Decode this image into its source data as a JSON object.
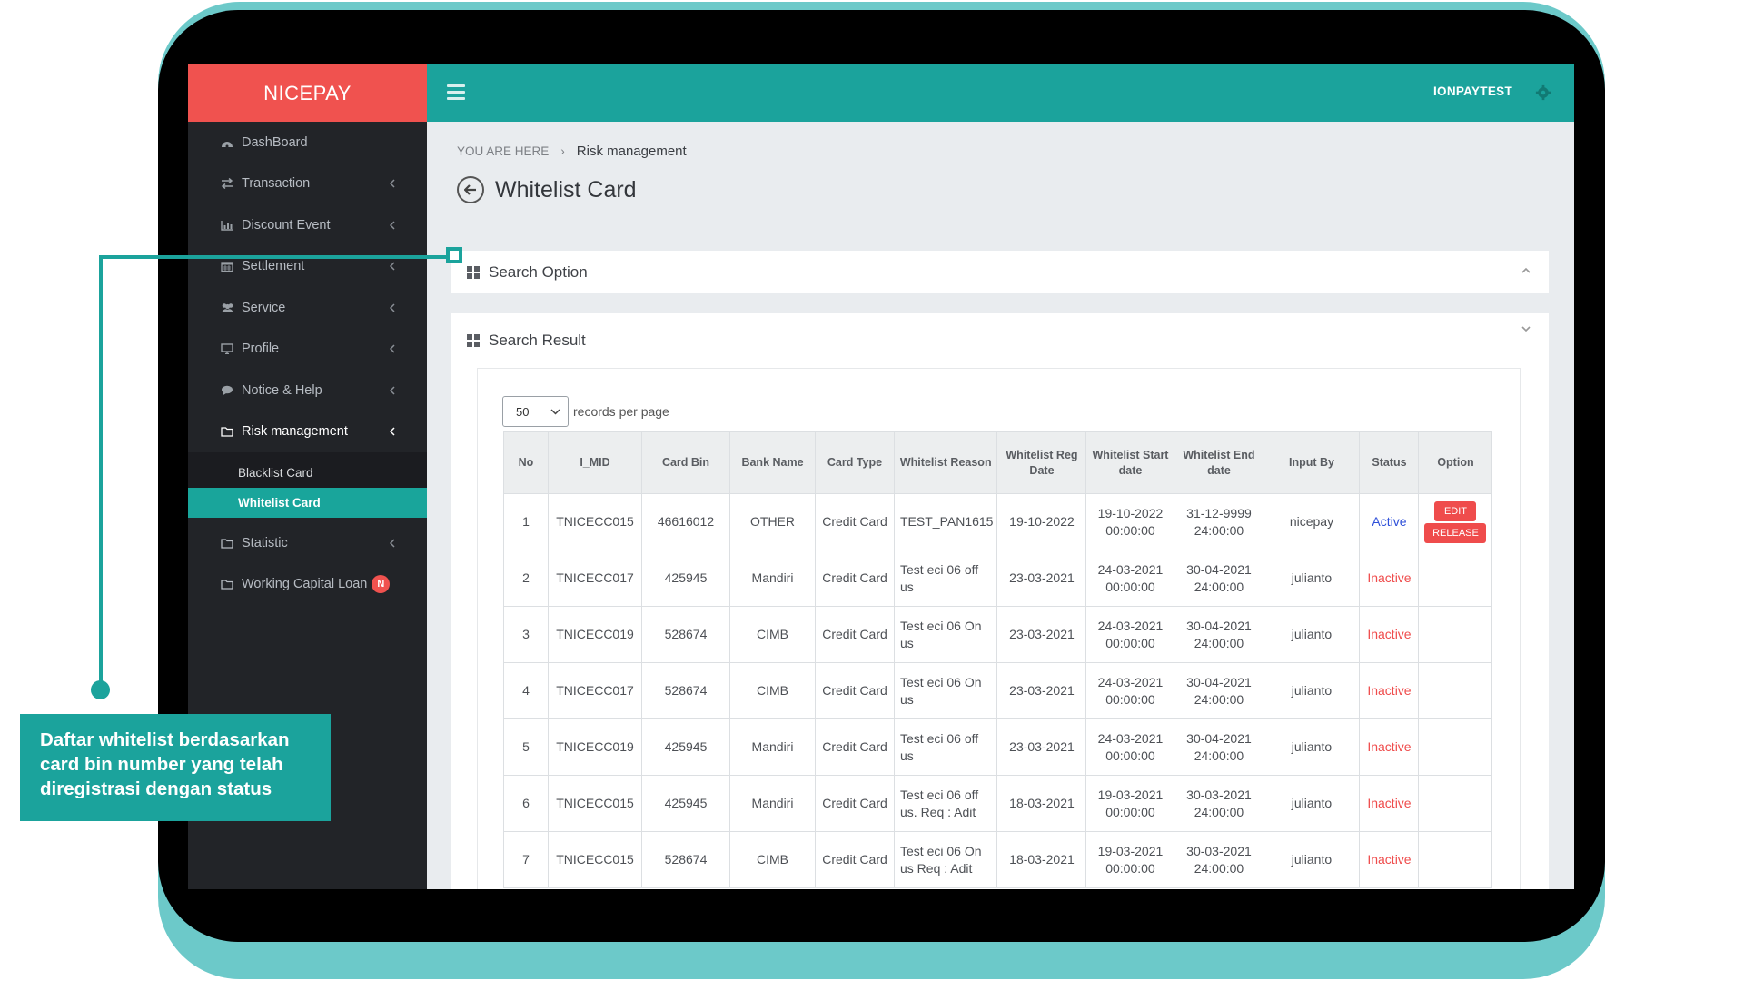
{
  "brand": "NICEPAY",
  "topbar": {
    "username": "IONPAYTEST"
  },
  "sidebar": {
    "items": [
      {
        "label": "DashBoard",
        "icon": "dashboard-icon",
        "has_chevron": false
      },
      {
        "label": "Transaction",
        "icon": "exchange-icon",
        "has_chevron": true
      },
      {
        "label": "Discount Event",
        "icon": "bar-chart-icon",
        "has_chevron": true
      },
      {
        "label": "Settlement",
        "icon": "calendar-icon",
        "has_chevron": true
      },
      {
        "label": "Service",
        "icon": "users-icon",
        "has_chevron": true
      },
      {
        "label": "Profile",
        "icon": "monitor-icon",
        "has_chevron": true
      },
      {
        "label": "Notice & Help",
        "icon": "chat-icon",
        "has_chevron": true
      },
      {
        "label": "Risk management",
        "icon": "folder-icon",
        "has_chevron": true,
        "active": true
      }
    ],
    "submenu": [
      {
        "label": "Blacklist Card"
      },
      {
        "label": "Whitelist Card",
        "selected": true
      }
    ],
    "items_after": [
      {
        "label": "Statistic",
        "icon": "folder-icon",
        "has_chevron": true
      },
      {
        "label": "Working Capital Loan",
        "icon": "folder-icon",
        "badge": "N"
      }
    ]
  },
  "breadcrumb": {
    "prefix": "YOU ARE HERE",
    "separator": "›",
    "current": "Risk management"
  },
  "page": {
    "title": "Whitelist Card"
  },
  "search_option": {
    "title": "Search Option"
  },
  "search_result": {
    "title": "Search Result",
    "page_length": "50",
    "page_length_label": "records per page",
    "columns": [
      "No",
      "I_MID",
      "Card Bin",
      "Bank Name",
      "Card Type",
      "Whitelist Reason",
      "Whitelist Reg Date",
      "Whitelist Start date",
      "Whitelist End date",
      "Input By",
      "Status",
      "Option"
    ],
    "rows": [
      {
        "no": "1",
        "mid": "TNICECC015",
        "bin": "46616012",
        "bank": "OTHER",
        "type": "Credit Card",
        "reason": "TEST_PAN1615",
        "reg": "19-10-2022",
        "start": "19-10-2022 00:00:00",
        "end": "31-12-9999 24:00:00",
        "by": "nicepay",
        "status": "Active",
        "edit": "EDIT",
        "release": "RELEASE"
      },
      {
        "no": "2",
        "mid": "TNICECC017",
        "bin": "425945",
        "bank": "Mandiri",
        "type": "Credit Card",
        "reason": "Test eci 06 off us",
        "reg": "23-03-2021",
        "start": "24-03-2021 00:00:00",
        "end": "30-04-2021 24:00:00",
        "by": "julianto",
        "status": "Inactive"
      },
      {
        "no": "3",
        "mid": "TNICECC019",
        "bin": "528674",
        "bank": "CIMB",
        "type": "Credit Card",
        "reason": "Test eci 06 On us",
        "reg": "23-03-2021",
        "start": "24-03-2021 00:00:00",
        "end": "30-04-2021 24:00:00",
        "by": "julianto",
        "status": "Inactive"
      },
      {
        "no": "4",
        "mid": "TNICECC017",
        "bin": "528674",
        "bank": "CIMB",
        "type": "Credit Card",
        "reason": "Test eci 06 On us",
        "reg": "23-03-2021",
        "start": "24-03-2021 00:00:00",
        "end": "30-04-2021 24:00:00",
        "by": "julianto",
        "status": "Inactive"
      },
      {
        "no": "5",
        "mid": "TNICECC019",
        "bin": "425945",
        "bank": "Mandiri",
        "type": "Credit Card",
        "reason": "Test eci 06 off us",
        "reg": "23-03-2021",
        "start": "24-03-2021 00:00:00",
        "end": "30-04-2021 24:00:00",
        "by": "julianto",
        "status": "Inactive"
      },
      {
        "no": "6",
        "mid": "TNICECC015",
        "bin": "425945",
        "bank": "Mandiri",
        "type": "Credit Card",
        "reason": "Test eci 06 off us. Req : Adit",
        "reg": "18-03-2021",
        "start": "19-03-2021 00:00:00",
        "end": "30-03-2021 24:00:00",
        "by": "julianto",
        "status": "Inactive"
      },
      {
        "no": "7",
        "mid": "TNICECC015",
        "bin": "528674",
        "bank": "CIMB",
        "type": "Credit Card",
        "reason": "Test eci 06 On us Req : Adit",
        "reg": "18-03-2021",
        "start": "19-03-2021 00:00:00",
        "end": "30-03-2021 24:00:00",
        "by": "julianto",
        "status": "Inactive"
      }
    ]
  },
  "callout": {
    "text": "Daftar whitelist berdasarkan card bin number yang telah diregistrasi dengan status"
  },
  "colors": {
    "brand": "#f0524f",
    "accent": "#1ba39c",
    "sidebar": "#222428",
    "active_status": "#2e4fd9",
    "inactive_status": "#ef4c4c"
  }
}
